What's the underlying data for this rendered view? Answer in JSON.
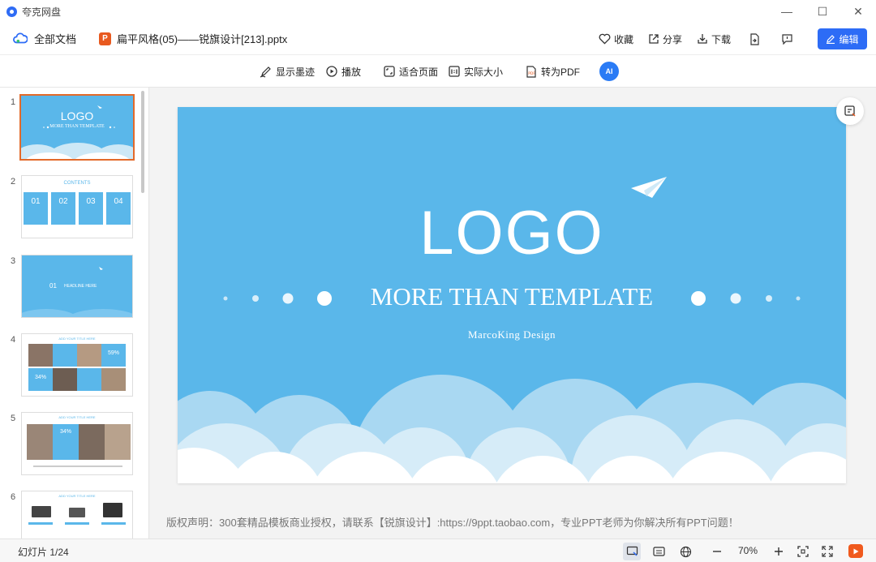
{
  "app": {
    "title": "夸克网盘"
  },
  "window": {
    "minimize": "—",
    "maximize": "☐",
    "close": "✕"
  },
  "header": {
    "all_docs": "全部文档",
    "file_badge": "P",
    "file_name": "扁平风格(05)——锐旗设计[213].pptx",
    "favorite": "收藏",
    "share": "分享",
    "download": "下载",
    "edit": "编辑"
  },
  "toolbar": {
    "show_ink": "显示墨迹",
    "play": "播放",
    "fit_page": "适合页面",
    "actual_size": "实际大小",
    "to_pdf": "转为PDF",
    "ai": "AI"
  },
  "thumbnails": {
    "numbers": [
      "1",
      "2",
      "3",
      "4",
      "5",
      "6"
    ],
    "t1": {
      "logo": "LOGO",
      "sub": "MORE THAN TEMPLATE"
    },
    "t2": {
      "title": "CONTENTS",
      "items": [
        "01",
        "02",
        "03",
        "04"
      ]
    },
    "t3": {
      "num": "01",
      "title": "HEADLINE HERE"
    },
    "t4": {
      "header": "ADD YOUR TITLE HERE",
      "p1": "59%",
      "p2": "34%"
    },
    "t5": {
      "header": "ADD YOUR TITLE HERE",
      "p1": "34%"
    },
    "t6": {
      "header": "ADD YOUR TITLE HERE"
    }
  },
  "slide": {
    "logo": "LOGO",
    "subtitle": "MORE THAN TEMPLATE",
    "designer": "MarcoKing Design",
    "background_color": "#5ab7ea"
  },
  "copyright": "版权声明：300套精品模板商业授权，请联系【锐旗设计】:https://9ppt.taobao.com，专业PPT老师为你解决所有PPT问题！",
  "status": {
    "slide_count": "幻灯片 1/24",
    "zoom": "70%"
  },
  "colors": {
    "accent": "#2d6cf6",
    "selected_border": "#e36a2a",
    "ppt_orange": "#e8591f"
  }
}
